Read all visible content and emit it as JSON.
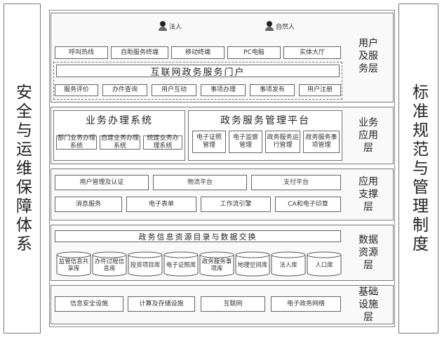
{
  "left_side": "安全与运维保障体系",
  "right_side": "标准规范与管理制度",
  "layers": {
    "user": {
      "name": "用户及服务层",
      "persons": [
        "法人",
        "自然人"
      ],
      "channels": [
        "实体大厅",
        "PC电脑",
        "移动终端",
        "自助服务终端",
        "呼叫热线"
      ],
      "portal": "互联网政务服务门户",
      "functions": [
        "用户注册",
        "事项发布",
        "事项办理",
        "用户互动",
        "办件查询",
        "服务评价"
      ]
    },
    "business": {
      "name": "业务应用层",
      "platform_title": "政务服务管理平台",
      "platform_items": [
        "政务服务事项管理",
        "政务服务运行管理",
        "电子监察管理",
        "电子证照管理"
      ],
      "system_title": "业务办理系统",
      "system_items": [
        "统建业务办理系统",
        "自建业务办理系统",
        "部门业务办理系统"
      ]
    },
    "support": {
      "name": "应用支撑层",
      "row1": [
        "支付平台",
        "物流平台",
        "用户管理及认证"
      ],
      "row2": [
        "CA和电子印章",
        "工作流引擎",
        "电子表单",
        "消息服务"
      ]
    },
    "data": {
      "name": "数据资源层",
      "banner": "政务信息资源目录与数据交换",
      "dbs": [
        "人口库",
        "法人库",
        "地理空间库",
        "政务服务事项库",
        "电子证照库",
        "投资项目库",
        "办件过程信息库",
        "监管信息共享库"
      ]
    },
    "infra": {
      "name": "基础设施层",
      "items": [
        "电子政务网络",
        "互联网",
        "计算及存储设施",
        "信息安全设施"
      ]
    }
  }
}
